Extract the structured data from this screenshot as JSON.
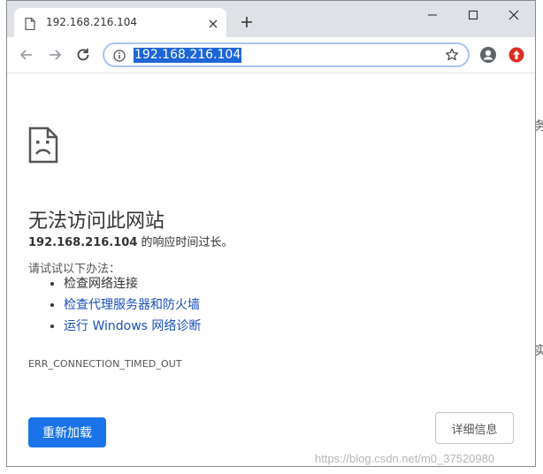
{
  "tab": {
    "title": "192.168.216.104"
  },
  "omnibox": {
    "url": "192.168.216.104"
  },
  "error": {
    "heading": "无法访问此网站",
    "host": "192.168.216.104",
    "desc_suffix": " 的响应时间过长。",
    "try_label": "请试试以下办法：",
    "suggestions": [
      {
        "text": "检查网络连接",
        "link": false
      },
      {
        "text": "检查代理服务器和防火墙",
        "link": true
      },
      {
        "text": "运行 Windows 网络诊断",
        "link": true
      }
    ],
    "code": "ERR_CONNECTION_TIMED_OUT"
  },
  "buttons": {
    "reload": "重新加载",
    "details": "详细信息"
  },
  "background": {
    "frag1": "务",
    "frag2": "实"
  },
  "watermark": "https://blog.csdn.net/m0_37520980",
  "colors": {
    "accent": "#1a73e8",
    "link": "#1a4fbf",
    "titlebar": "#dee1e6"
  }
}
